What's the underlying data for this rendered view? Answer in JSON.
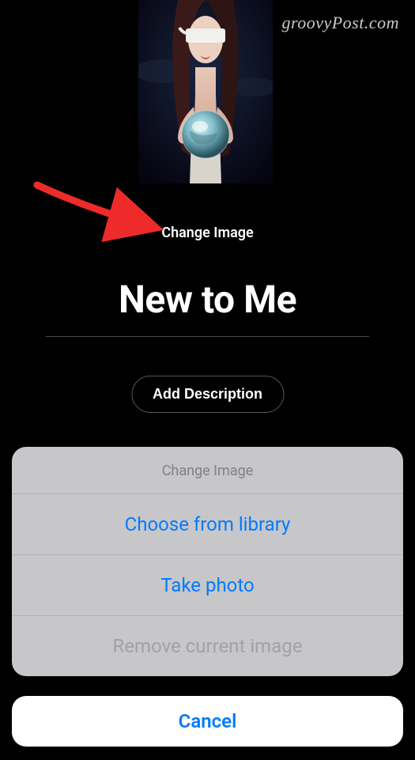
{
  "watermark": "groovyPost.com",
  "change_image_link": "Change Image",
  "playlist_title": "New to Me",
  "add_description_label": "Add Description",
  "action_sheet": {
    "title": "Change Image",
    "options": {
      "choose": "Choose from library",
      "take_photo": "Take photo",
      "remove": "Remove current image"
    },
    "cancel": "Cancel"
  },
  "colors": {
    "accent_blue": "#007aff",
    "arrow_red": "#ee2b2b"
  }
}
